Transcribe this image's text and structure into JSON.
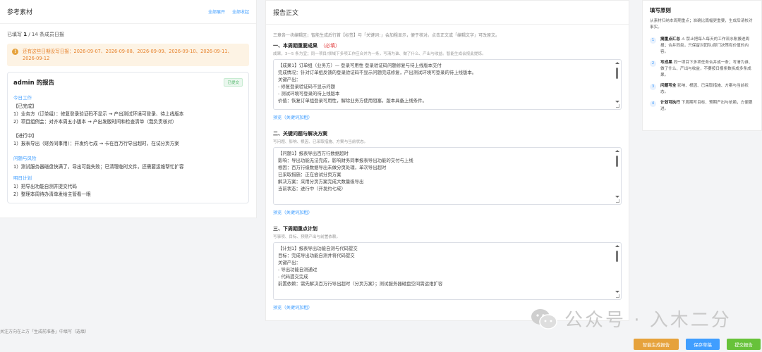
{
  "left": {
    "title": "参考素材",
    "expand_all": "全部展开",
    "collapse_all": "全部收起",
    "count_prefix": "已填写 ",
    "count_value": "1",
    "count_suffix": " / 14 条成员日报",
    "warning": "还有这些日期没写日报：2026-09-07、2026-09-08、2026-09-09、2026-09-10、2026-09-11、2026-09-12",
    "card": {
      "title": "admin 的报告",
      "badge": "已提交",
      "today_label": "今日工作",
      "done_label": "【已完成】",
      "done_items": [
        "1）业务方（订单组）：修复登录验证码不显示 → 产出测试环境可登录、待上线版本",
        "2）项目组例会：对齐本周五小版本 → 产出发版时间和检查清单（我负责核对）"
      ],
      "progress_label": "【进行中】",
      "progress_items": [
        "1）报表导出（财务同事用）：开发约七成 → 卡在百万行导出超时，在试分页方案"
      ],
      "risk_label": "问题与风险",
      "risk_items": [
        "1）测试服务器磁盘快满了，导出可能失败；已清理临时文件，还需要运维帮忙扩容"
      ],
      "plan_label": "明日计划",
      "plan_items": [
        "1）把导出功能自测并提交代码",
        "2）整理本周待办清单发给主管看一眼"
      ]
    },
    "footer": "关注方向在上方「生成前准备」中填写（选填）"
  },
  "center": {
    "title": "报告正文",
    "hint": "三章各一块编辑区；智能生成后行首【标签】与「关键词：」会加粗显示，便于核对。点击正文或「编辑文字」可改原文。",
    "sections": [
      {
        "title": "一、本周期重要成果",
        "required": "（必填）",
        "hint": "成果，3～5 条为宜；同一项目/领域下多项工作应合并为一条，写清为谁、做了什么、产出与收益。智能生成会按此提炼。",
        "lines": [
          "【成果1】订单组（业务方）— 登录可用性   登录验证码问题修复与待上线版本交付",
          "完成情况：针对订单组反馈的登录验证码不显示问题完成修复，产出测试环境可登录的待上线版本。",
          "关键产出：",
          "- 修复登录验证码不显示问题",
          "- 测试环境可登录的待上线版本",
          "价值：恢复订单组登录可用性，解除业务方使用阻塞，版本具备上线条件。"
        ],
        "preview": "预览（关键词加粗）"
      },
      {
        "title": "二、关键问题与解决方案",
        "required": "",
        "hint": "写问题、影响、根因、已采取措施、方案与当前状态。",
        "lines": [
          "【问题1】报表导出百万行数据超时",
          "影响：导出功能无法完成，影响财务同事报表导出功能的交付与上线",
          "根因：百万行级数据导出未做分页处理，单次导出超时",
          "已采取措施：正在尝试分页方案",
          "解决方案：采用分页方案完成大数量级导出",
          "当前状态：进行中（开发约七成）"
        ],
        "preview": "预览（关键词加粗）"
      },
      {
        "title": "三、下周期重点计划",
        "required": "",
        "hint": "写事项、目标、预期产出与前置依赖。",
        "lines": [
          "【计划1】报表导出功能自测与代码提交",
          "目标：完成导出功能自测并将代码提交",
          "关键产出：",
          "- 导出功能自测通过",
          "- 代码提交完成",
          "前置依赖：需先解决百万行导出超时（分页方案）；测试服务器磁盘空间需运维扩容"
        ],
        "preview": "预览（关键词加粗）"
      }
    ]
  },
  "right": {
    "title": "填写原则",
    "subtitle": "从素材归纳本周期重点；准确比篇幅更重要，生成后请核对事实。",
    "items": [
      {
        "num": "1",
        "bold": "摘重点汇总",
        "text": " ⚠ 禁止把每人每天的工作流水账搬进周报；合并同类，只保留对团队/部门决策有价值的内容。"
      },
      {
        "num": "2",
        "bold": "写成果",
        "text": " 同一项目下多项任务合并成一条；写清为谁、做了什么、产出与收益，不要按日报条数拆成多条成果。"
      },
      {
        "num": "3",
        "bold": "问题写全",
        "text": " 影响、根因、已采取措施、方案与当前状态。"
      },
      {
        "num": "4",
        "bold": "计划可执行",
        "text": " 下周期写目标、预期产出与依赖，方便跟进。"
      }
    ]
  },
  "watermark": "公众号 · 入木二分",
  "buttons": {
    "ai": "智能生成报告",
    "save": "保存草稿",
    "submit": "提交报告"
  },
  "colors": {
    "accent": "#409eff",
    "warning": "#e6a23c",
    "success": "#67c23a",
    "required": "#e23b3b"
  }
}
